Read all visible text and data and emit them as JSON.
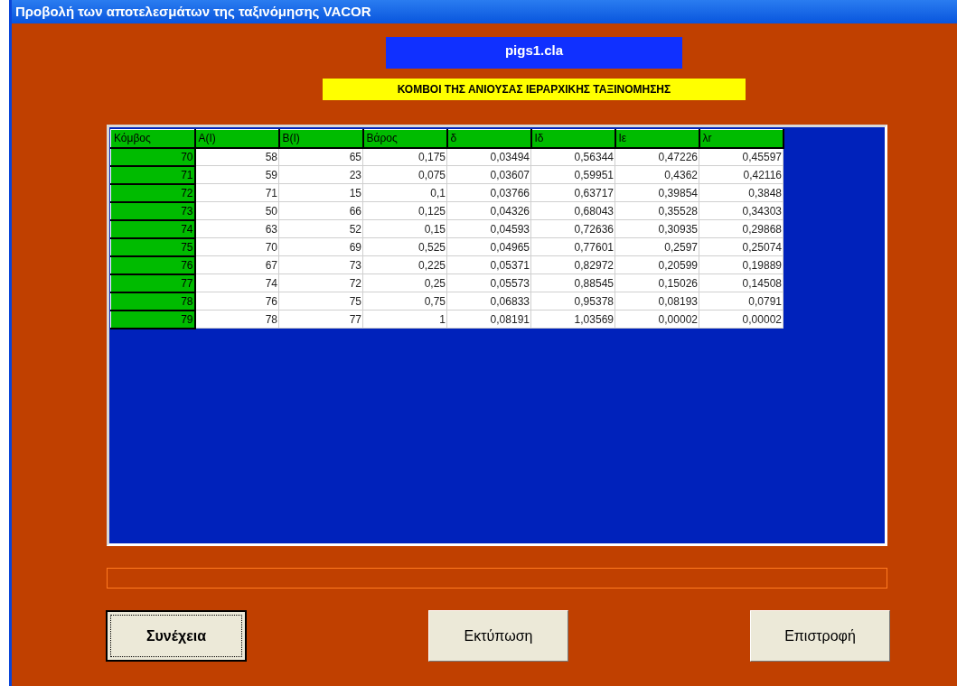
{
  "window": {
    "title": "Προβολή των αποτελεσμάτων της ταξινόμησης VACOR"
  },
  "file_name": "pigs1.cla",
  "heading": "ΚΟΜΒΟΙ ΤΗΣ ΑΝΙΟΥΣΑΣ ΙΕΡΑΡΧΙΚΗΣ ΤΑΞΙΝΟΜΗΣΗΣ",
  "table": {
    "columns": [
      "Κόμβος",
      "A(I)",
      "B(I)",
      "Βάρος",
      "δ",
      "Iδ",
      "Iε",
      "λr"
    ],
    "rows": [
      [
        "70",
        "58",
        "65",
        "0,175",
        "0,03494",
        "0,56344",
        "0,47226",
        "0,45597"
      ],
      [
        "71",
        "59",
        "23",
        "0,075",
        "0,03607",
        "0,59951",
        "0,4362",
        "0,42116"
      ],
      [
        "72",
        "71",
        "15",
        "0,1",
        "0,03766",
        "0,63717",
        "0,39854",
        "0,3848"
      ],
      [
        "73",
        "50",
        "66",
        "0,125",
        "0,04326",
        "0,68043",
        "0,35528",
        "0,34303"
      ],
      [
        "74",
        "63",
        "52",
        "0,15",
        "0,04593",
        "0,72636",
        "0,30935",
        "0,29868"
      ],
      [
        "75",
        "70",
        "69",
        "0,525",
        "0,04965",
        "0,77601",
        "0,2597",
        "0,25074"
      ],
      [
        "76",
        "67",
        "73",
        "0,225",
        "0,05371",
        "0,82972",
        "0,20599",
        "0,19889"
      ],
      [
        "77",
        "74",
        "72",
        "0,25",
        "0,05573",
        "0,88545",
        "0,15026",
        "0,14508"
      ],
      [
        "78",
        "76",
        "75",
        "0,75",
        "0,06833",
        "0,95378",
        "0,08193",
        "0,0791"
      ],
      [
        "79",
        "78",
        "77",
        "1",
        "0,08191",
        "1,03569",
        "0,00002",
        "0,00002"
      ]
    ]
  },
  "progress": {
    "level": 0
  },
  "buttons": [
    {
      "label": "Συνέχεια",
      "default": true
    },
    {
      "label": "Εκτύπωση",
      "default": false
    },
    {
      "label": "Επιστροφή",
      "default": false
    }
  ]
}
